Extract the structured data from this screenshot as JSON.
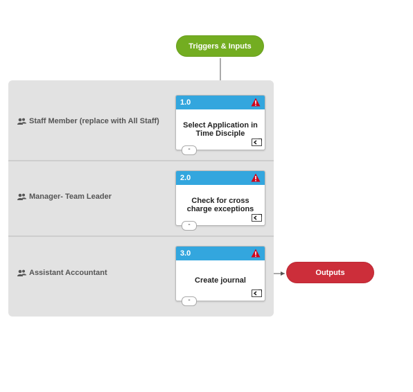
{
  "start": {
    "label": "Triggers & Inputs",
    "color": "#73ad21"
  },
  "end": {
    "label": "Outputs",
    "color": "#cc2e3a"
  },
  "lanes": [
    {
      "label": "Staff Member (replace with All Staff)"
    },
    {
      "label": "Manager- Team Leader"
    },
    {
      "label": "Assistant Accountant"
    }
  ],
  "steps": [
    {
      "number": "1.0",
      "title": "Select Application in Time Disciple",
      "collapse": "-"
    },
    {
      "number": "2.0",
      "title": "Check for cross charge exceptions",
      "collapse": "-"
    },
    {
      "number": "3.0",
      "title": "Create journal",
      "collapse": "-"
    }
  ],
  "colors": {
    "header": "#33a6de",
    "lane_bg": "#e2e2e2",
    "warning": "#d0021b"
  },
  "icons": {
    "lane": "people-icon",
    "step_flag": "warning-icon",
    "step_link": "link-icon"
  }
}
